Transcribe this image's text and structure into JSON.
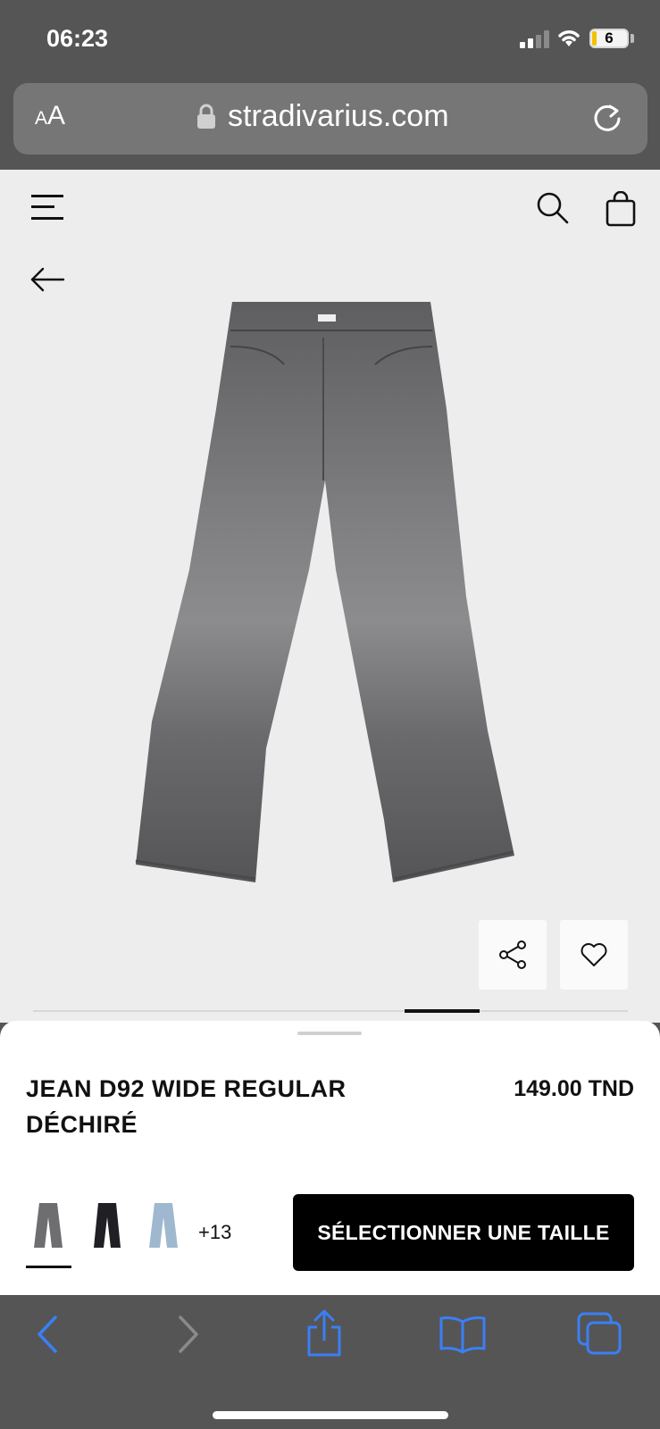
{
  "status_bar": {
    "time": "06:23",
    "battery": "6"
  },
  "browser": {
    "aa_small": "A",
    "aa_large": "A",
    "url": "stradivarius.com"
  },
  "product": {
    "name": "JEAN D92 WIDE REGULAR DÉCHIRÉ",
    "price": "149.00 TND",
    "more_colors": "+13",
    "cta_label": "SÉLECTIONNER UNE TAILLE",
    "gallery_progress": {
      "index": 6,
      "total": 8
    }
  },
  "colors": {
    "page_bg": "#ededed",
    "chrome_bg": "#555555",
    "denim_grey": "#6e6e70",
    "denim_black": "#1f1f24",
    "denim_light_blue": "#9fb8cf",
    "safari_blue": "#3b7ff5"
  },
  "icons": [
    "menu-icon",
    "search-icon",
    "bag-icon",
    "back-arrow-icon",
    "share-icon",
    "heart-icon",
    "lock-icon",
    "reload-icon",
    "back-nav-icon",
    "forward-nav-icon",
    "share-nav-icon",
    "bookmarks-icon",
    "tabs-icon"
  ]
}
